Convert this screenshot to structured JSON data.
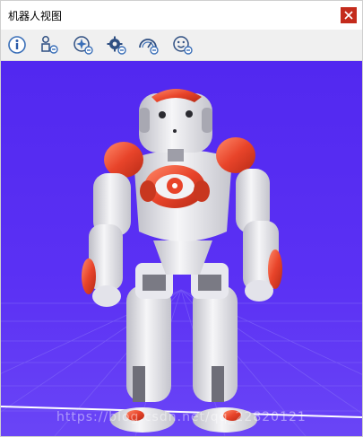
{
  "window": {
    "title": "机器人视图",
    "close_icon": "close-icon"
  },
  "toolbar": {
    "tools": [
      {
        "name": "info",
        "icon": "info-icon"
      },
      {
        "name": "joints",
        "icon": "joints-icon"
      },
      {
        "name": "sparkle",
        "icon": "sparkle-icon"
      },
      {
        "name": "gear",
        "icon": "gear-icon"
      },
      {
        "name": "dashboard",
        "icon": "gauge-icon"
      },
      {
        "name": "face",
        "icon": "face-icon"
      }
    ]
  },
  "viewport": {
    "background": "#5a2bf2",
    "robot_accent": "#e8442a",
    "watermark": "https://blog.csdn.net/qq_22820121"
  }
}
